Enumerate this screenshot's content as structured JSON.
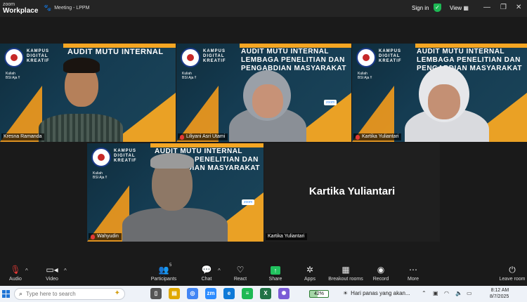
{
  "app": {
    "brand_line1": "zoom",
    "brand_line2": "Workplace",
    "meeting_title": "Meeting - LPPM",
    "signin_label": "Sign in",
    "view_label": "View"
  },
  "slide": {
    "logo_text_line1": "KAMPUS",
    "logo_text_line2": "DIGITAL",
    "logo_text_line3": "KREATIF",
    "kuliah_line1": "Kuliah",
    "kuliah_line2": "BSI Aja !!",
    "title_line1": "AUDIT MUTU INTERNAL",
    "title_line2": "LEMBAGA PENELITIAN DAN",
    "title_line3": "PENGABDIAN MASYARAKAT",
    "zoom_chip": "zoom"
  },
  "participants": [
    {
      "name": "Kresna Ramanda",
      "muted": false,
      "active": true
    },
    {
      "name": "Liliyani Asri Utami",
      "muted": true,
      "active": false
    },
    {
      "name": "Kartika Yuliantari",
      "muted": true,
      "active": false
    },
    {
      "name": "Wahyudin",
      "muted": true,
      "active": false
    },
    {
      "name": "Kartika Yuliantari",
      "muted": false,
      "active": false
    }
  ],
  "blank_tile_big_name": "Kartika Yuliantari",
  "toolbar": {
    "audio": "Audio",
    "video": "Video",
    "participants": "Participants",
    "participants_count": "5",
    "chat": "Chat",
    "react": "React",
    "share": "Share",
    "apps": "Apps",
    "breakout": "Breakout rooms",
    "record": "Record",
    "more": "More",
    "leave": "Leave room"
  },
  "taskbar": {
    "search_placeholder": "Type here to search",
    "battery": "42%",
    "news": "Hari panas yang akan...",
    "time": "8:12 AM",
    "date": "8/7/2025"
  },
  "colors": {
    "active_speaker": "#3bd14a",
    "share_green": "#21c25e",
    "mute_red": "#e53935",
    "slide_orange": "#f5a623"
  }
}
